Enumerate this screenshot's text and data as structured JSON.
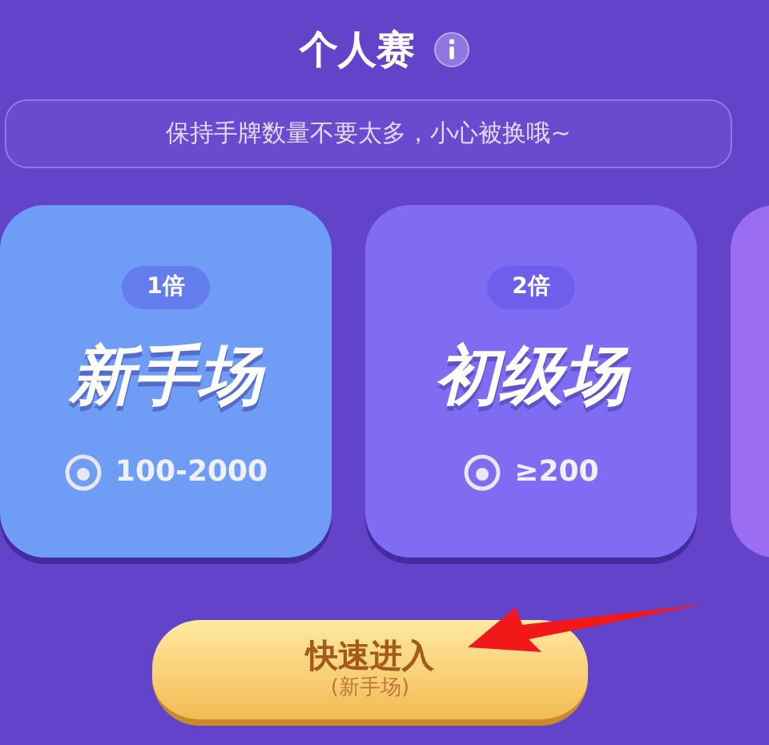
{
  "title": "个人赛",
  "tip": "保持手牌数量不要太多，小心被换哦~",
  "rooms": [
    {
      "multiplier": "1倍",
      "name": "新手场",
      "range": "100-2000",
      "color": "#6f9cf5"
    },
    {
      "multiplier": "2倍",
      "name": "初级场",
      "range": "≥200",
      "color": "#7f6cf3"
    }
  ],
  "quick_button": {
    "label": "快速进入",
    "sub": "(新手场)"
  }
}
